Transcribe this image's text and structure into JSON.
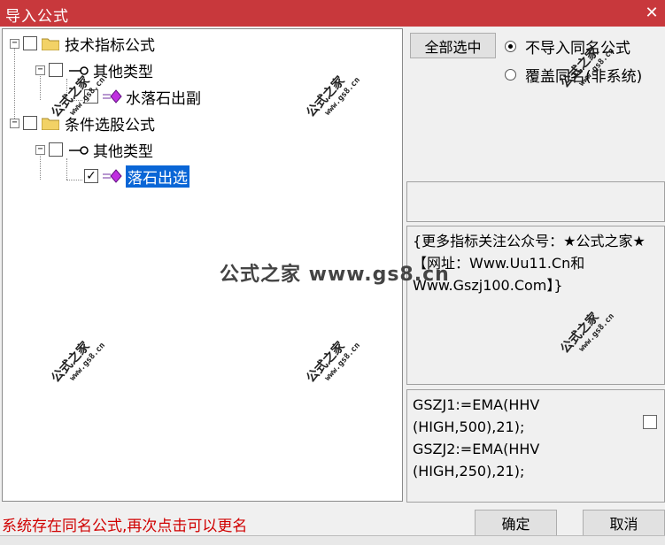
{
  "window": {
    "title": "导入公式",
    "close_glyph": "✕"
  },
  "tree": {
    "nodes": [
      {
        "label": "技术指标公式",
        "icon": "folder-icon",
        "checked": false,
        "selected": false
      },
      {
        "label": "其他类型",
        "icon": "key-icon",
        "checked": false,
        "selected": false
      },
      {
        "label": "水落石出副",
        "icon": "gem-icon",
        "checked": false,
        "selected": false
      },
      {
        "label": "条件选股公式",
        "icon": "folder-icon",
        "checked": false,
        "selected": false
      },
      {
        "label": "其他类型",
        "icon": "key-icon",
        "checked": false,
        "selected": false
      },
      {
        "label": "落石出选",
        "icon": "gem-icon",
        "checked": true,
        "selected": true
      }
    ]
  },
  "buttons": {
    "select_all": "全部选中",
    "ok": "确定",
    "cancel": "取消"
  },
  "options": {
    "no_import_same": "不导入同名公式",
    "overwrite_same": "覆盖同名(非系统)",
    "selected": "no_import_same"
  },
  "info_text": "{更多指标关注公众号：★公式之家★ 【网址：Www.Uu11.Cn和Www.Gszj100.Com】}",
  "code_lines": [
    "GSZJ1:=EMA(HHV",
    "(HIGH,500),21);",
    "GSZJ2:=EMA(HHV",
    "(HIGH,250),21);"
  ],
  "status_message": "系统存在同名公式,再次点击可以更名",
  "watermark": {
    "text": "公式之家",
    "url": "www.gs8.cn",
    "banner": "公式之家 www.gs8.cn"
  },
  "colors": {
    "title_bar": "#c8383c",
    "selection": "#0a66d6",
    "status_text": "#d00000"
  }
}
